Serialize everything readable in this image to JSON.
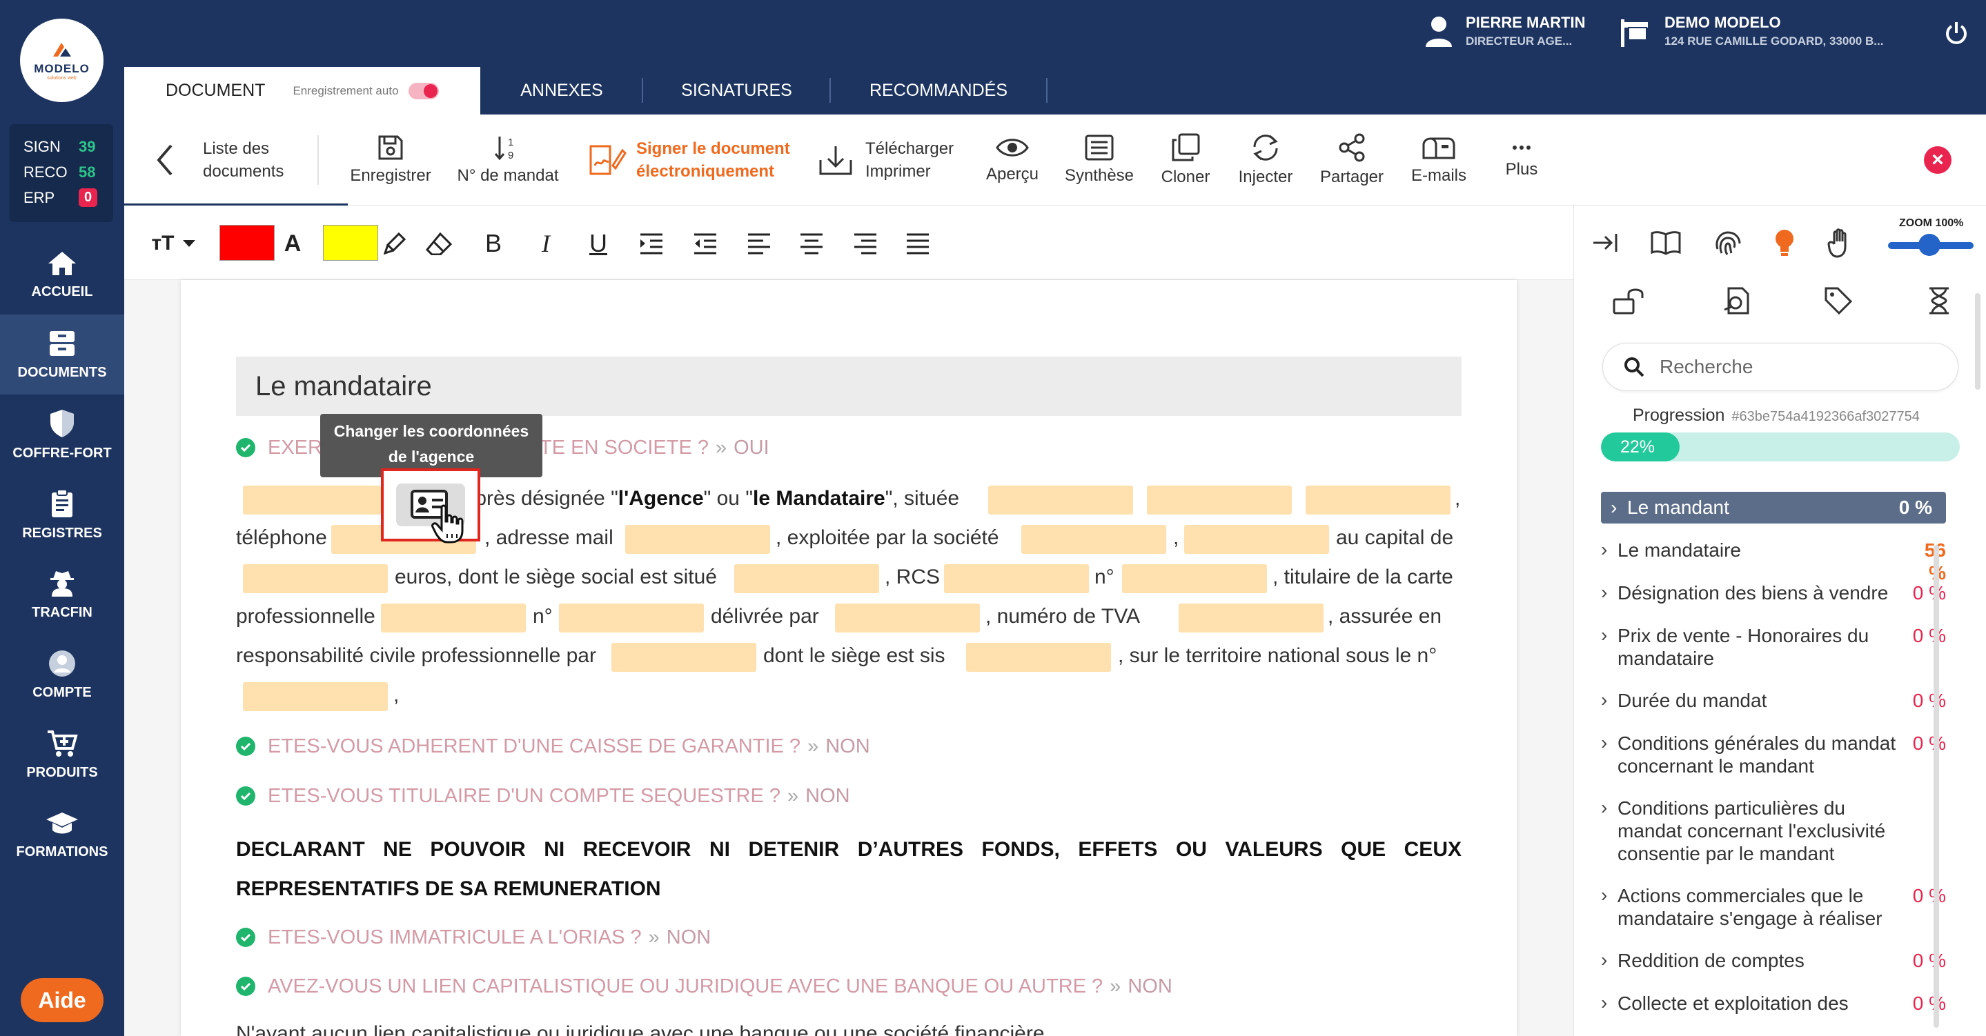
{
  "app": {
    "logo_text": "MODELO",
    "logo_sub": "solutions web"
  },
  "counters": [
    {
      "label": "SIGN",
      "value": "39"
    },
    {
      "label": "RECO",
      "value": "58"
    },
    {
      "label": "ERP",
      "value": "0"
    }
  ],
  "nav": [
    {
      "label": "ACCUEIL",
      "icon": "home-icon"
    },
    {
      "label": "DOCUMENTS",
      "icon": "drawer-icon"
    },
    {
      "label": "COFFRE-FORT",
      "icon": "shield-icon"
    },
    {
      "label": "REGISTRES",
      "icon": "clipboard-icon"
    },
    {
      "label": "TRACFIN",
      "icon": "detective-icon"
    },
    {
      "label": "COMPTE",
      "icon": "user-icon"
    },
    {
      "label": "PRODUITS",
      "icon": "cart-icon"
    },
    {
      "label": "FORMATIONS",
      "icon": "graduation-icon"
    }
  ],
  "help_label": "Aide",
  "user": {
    "name": "PIERRE MARTIN",
    "role": "DIRECTEUR AGE..."
  },
  "agency": {
    "name": "DEMO MODELO",
    "address": "124 RUE CAMILLE GODARD, 33000 B..."
  },
  "tabs": {
    "document": "DOCUMENT",
    "autosave": "Enregistrement auto",
    "annexes": "ANNEXES",
    "signatures": "SIGNATURES",
    "recommandes": "RECOMMANDÉS"
  },
  "toolbar": {
    "back_line1": "Liste des",
    "back_line2": "documents",
    "save": "Enregistrer",
    "mandate_no": "N° de mandat",
    "sign_line1": "Signer le document",
    "sign_line2": "électroniquement",
    "download_line1": "Télécharger",
    "download_line2": "Imprimer",
    "preview": "Aperçu",
    "synthese": "Synthèse",
    "clone": "Cloner",
    "inject": "Injecter",
    "share": "Partager",
    "emails": "E-mails",
    "more": "Plus"
  },
  "colors": {
    "text_color": "#ff0000",
    "highlight_color": "#ffff00",
    "accent": "#1d3461",
    "orange": "#ef6a1e"
  },
  "document": {
    "section_title": "Le mandataire",
    "q1_prefix": "EXER",
    "q1_suffix": "ITE EN SOCIETE ?",
    "q1_answer": "OUI",
    "p_line1_a": "ci-après désignée \"",
    "p_line1_b": "l'Agence",
    "p_line1_c": "\" ou \"",
    "p_line1_d": "le Mandataire",
    "p_line1_e": "\", située",
    "p_comma": ",",
    "p_telephone": "téléphone",
    "p_mail": ", adresse mail",
    "p_exploitee": ", exploitée par la société",
    "p_capital": "au capital de",
    "p_euros": "euros, dont le siège social est situé",
    "p_rcs": ", RCS",
    "p_no": "n°",
    "p_titulaire": ", titulaire de la carte",
    "p_professionnelle": "professionnelle",
    "p_no2": "n°",
    "p_delivree": "délivrée   par",
    "p_tva": ",   numéro   de   TVA",
    "p_assuree": ",   assurée   en",
    "p_responsabilite": "responsabilité civile professionnelle par",
    "p_siege": "dont le siège est sis",
    "p_territoire": ", sur le territoire national sous le n°",
    "q2": "ETES-VOUS ADHERENT D'UNE CAISSE DE GARANTIE ?",
    "q2_answer": "NON",
    "q3": "ETES-VOUS TITULAIRE D'UN COMPTE SEQUESTRE ?",
    "q3_answer": "NON",
    "declarant": "DECLARANT NE POUVOIR NI RECEVOIR NI DETENIR D’AUTRES FONDS, EFFETS OU VALEURS QUE CEUX REPRESENTATIFS DE SA REMUNERATION",
    "q4": "ETES-VOUS IMMATRICULE A L'ORIAS ?",
    "q4_answer": "NON",
    "q5": "AVEZ-VOUS UN LIEN CAPITALISTIQUE OU JURIDIQUE AVEC UNE BANQUE OU AUTRE ?",
    "q5_answer": "NON",
    "last_line": "N'ayant aucun lien capitalistique ou juridique avec une banque ou une société financière"
  },
  "tooltip": {
    "line1": "Changer les coordonnées",
    "line2": "de l'agence"
  },
  "right_panel": {
    "zoom_label": "ZOOM 100%",
    "search_placeholder": "Recherche",
    "progress_label": "Progression",
    "progress_id": "#63be754a4192366af3027754",
    "progress_value": 22,
    "progress_text": "22%",
    "sections": [
      {
        "label": "Le mandant",
        "pct": "0 %"
      },
      {
        "label": "Le mandataire",
        "pct": "56 %"
      },
      {
        "label": "Désignation des biens à vendre",
        "pct": "0 %"
      },
      {
        "label": "Prix de vente - Honoraires du mandataire",
        "pct": "0 %"
      },
      {
        "label": "Durée du mandat",
        "pct": "0 %"
      },
      {
        "label": "Conditions générales du mandat concernant le mandant",
        "pct": "0 %"
      },
      {
        "label": "Conditions particulières du mandat concernant l'exclusivité consentie par le mandant",
        "pct": ""
      },
      {
        "label": "Actions commerciales que le mandataire s'engage à réaliser",
        "pct": "0 %"
      },
      {
        "label": "Reddition de comptes",
        "pct": "0 %"
      },
      {
        "label": "Collecte et exploitation des",
        "pct": "0 %"
      }
    ]
  }
}
